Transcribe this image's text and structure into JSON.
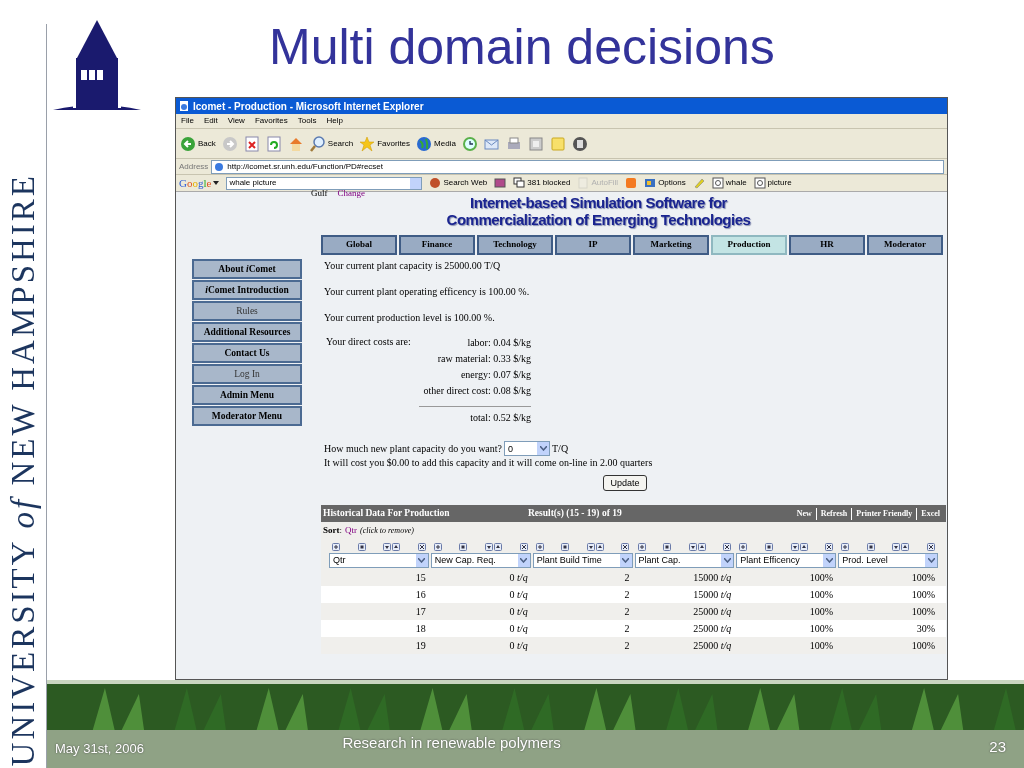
{
  "slide": {
    "title": "Multi domain decisions",
    "wordmark": "UNIVERSITY *of* NEW HAMPSHIRE",
    "footer": {
      "date": "May 31st, 2006",
      "topic": "Research in renewable polymers",
      "page": "23"
    }
  },
  "browser": {
    "title": "Icomet - Production - Microsoft Internet Explorer",
    "menu": [
      "File",
      "Edit",
      "View",
      "Favorites",
      "Tools",
      "Help"
    ],
    "toolbar": [
      {
        "kind": "back",
        "label": "Back"
      },
      {
        "kind": "forward"
      },
      {
        "kind": "stop"
      },
      {
        "kind": "refresh"
      },
      {
        "kind": "home"
      },
      {
        "kind": "search",
        "label": "Search"
      },
      {
        "kind": "favorites",
        "label": "Favorites"
      },
      {
        "kind": "media",
        "label": "Media"
      },
      {
        "kind": "history"
      },
      {
        "kind": "mail"
      },
      {
        "kind": "print"
      },
      {
        "kind": "edit"
      },
      {
        "kind": "note"
      },
      {
        "kind": "messenger"
      }
    ],
    "address_label": "Address",
    "url": "http://icomet.sr.unh.edu/Function/PD#recset",
    "google": {
      "brand": "Google",
      "query": "whale picture",
      "items": [
        {
          "kind": "search",
          "label": "Search Web",
          "disabled": false
        },
        {
          "kind": "news",
          "disabled": false
        },
        {
          "kind": "popup",
          "label": "381 blocked",
          "disabled": false
        },
        {
          "kind": "form",
          "label": "AutoFill",
          "disabled": true
        },
        {
          "kind": "blog",
          "disabled": false
        },
        {
          "kind": "options",
          "label": "Options",
          "disabled": false
        },
        {
          "kind": "highlight",
          "disabled": false
        },
        {
          "kind": "find",
          "label": "whale",
          "disabled": false
        },
        {
          "kind": "find",
          "label": "picture",
          "disabled": false
        }
      ]
    }
  },
  "page": {
    "team": "Gulf",
    "change_link": "Change",
    "header": [
      "Internet-based Simulation Software for",
      "Commercialization of Emerging Technologies"
    ],
    "tabs": [
      {
        "label": "Global",
        "selected": false
      },
      {
        "label": "Finance",
        "selected": false
      },
      {
        "label": "Technology",
        "selected": false
      },
      {
        "label": "IP",
        "selected": false
      },
      {
        "label": "Marketing",
        "selected": false
      },
      {
        "label": "Production",
        "selected": true
      },
      {
        "label": "HR",
        "selected": false
      },
      {
        "label": "Moderator",
        "selected": false
      }
    ],
    "sidebar": [
      {
        "label": [
          {
            "text": "About ",
            "italic": false
          },
          {
            "text": "i",
            "italic": true
          },
          {
            "text": "Comet",
            "italic": false
          }
        ],
        "disabled": false
      },
      {
        "label": [
          {
            "text": "i",
            "italic": true
          },
          {
            "text": "Comet Introduction",
            "italic": false
          }
        ],
        "disabled": false
      },
      {
        "label": [
          {
            "text": "Rules",
            "italic": false
          }
        ],
        "disabled": true
      },
      {
        "label": [
          {
            "text": "Additional Resources",
            "italic": false
          }
        ],
        "disabled": false
      },
      {
        "label": [
          {
            "text": "Contact Us",
            "italic": false
          }
        ],
        "disabled": false
      },
      {
        "label": [
          {
            "text": "Log In",
            "italic": false
          }
        ],
        "disabled": true
      },
      {
        "label": [
          {
            "text": "Admin Menu",
            "italic": false
          }
        ],
        "disabled": false
      },
      {
        "label": [
          {
            "text": "Moderator Menu",
            "italic": false
          }
        ],
        "disabled": false
      }
    ],
    "status": [
      "Your current plant capacity is 25000.00 T/Q",
      "Your current plant operating efficency is 100.00 %.",
      "Your current production level is 100.00 %."
    ],
    "direct_costs": {
      "label": "Your direct costs are:",
      "items": [
        "labor: 0.04 $/kg",
        "raw material: 0.33 $/kg",
        "energy: 0.07 $/kg",
        "other direct cost: 0.08 $/kg"
      ],
      "total": "total: 0.52 $/kg"
    },
    "capacity": {
      "question": "How much new plant capacity do you want?",
      "value": "0",
      "unit": "T/Q",
      "cost_note": "It will cost you $0.00 to add this capacity and it will come on-line in 2.00 quarters",
      "button": "Update"
    },
    "history": {
      "title": "Historical Data For Production",
      "results": "Result(s) (15 - 19) of 19",
      "actions": [
        "New",
        "Refresh",
        "Printer Friendly",
        "Excel"
      ],
      "sort_label": "**Sort**:",
      "sort_field": "Qtr",
      "sort_hint": "(click to remove)",
      "columns": [
        "Qtr",
        "New Cap. Req.",
        "Plant Build Time",
        "Plant Cap.",
        "Plant Efficency",
        "Prod. Level"
      ],
      "rows": [
        [
          "15",
          "0 *t/q*",
          "2",
          "15000 *t/q*",
          "100%",
          "100%"
        ],
        [
          "16",
          "0 *t/q*",
          "2",
          "15000 *t/q*",
          "100%",
          "100%"
        ],
        [
          "17",
          "0 *t/q*",
          "2",
          "25000 *t/q*",
          "100%",
          "100%"
        ],
        [
          "18",
          "0 *t/q*",
          "2",
          "25000 *t/q*",
          "100%",
          "30%"
        ],
        [
          "19",
          "0 *t/q*",
          "2",
          "25000 *t/q*",
          "100%",
          "100%"
        ]
      ]
    }
  }
}
